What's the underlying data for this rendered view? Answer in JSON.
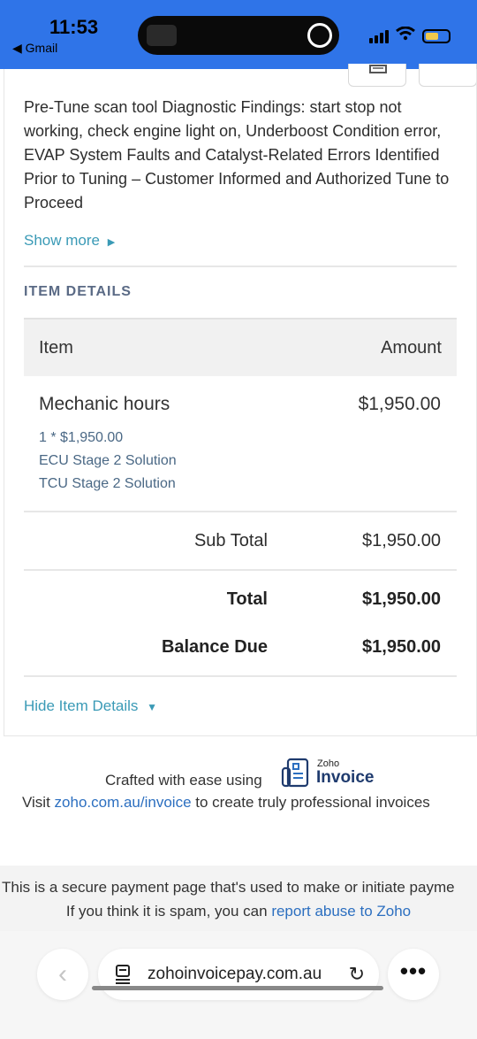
{
  "status_bar": {
    "time": "11:53",
    "back_app": "◀ Gmail"
  },
  "invoice": {
    "notes": "Pre-Tune scan tool Diagnostic Findings: start stop not working, check engine light on, Underboost Condition error, EVAP System Faults and Catalyst-Related Errors Identified Prior to Tuning – Customer Informed and Authorized Tune to Proceed",
    "show_more": "Show more",
    "section_title": "ITEM DETAILS",
    "columns": {
      "item": "Item",
      "amount": "Amount"
    },
    "line_item": {
      "title": "Mechanic hours",
      "amount": "$1,950.00",
      "details": [
        "1 * $1,950.00",
        "ECU Stage 2 Solution",
        "TCU Stage 2 Solution"
      ]
    },
    "sub_total": {
      "label": "Sub Total",
      "value": "$1,950.00"
    },
    "total": {
      "label": "Total",
      "value": "$1,950.00"
    },
    "balance_due": {
      "label": "Balance Due",
      "value": "$1,950.00"
    },
    "hide_items": "Hide Item Details"
  },
  "footer": {
    "crafted": "Crafted with ease using",
    "brand_small": "Zoho",
    "brand_big": "Invoice",
    "visit_prefix": "Visit",
    "visit_link": "zoho.com.au/invoice",
    "visit_suffix": "to create truly professional invoices"
  },
  "secure": {
    "line1": "This is a secure payment page that's used to make or initiate payme",
    "line2_prefix": "If you think it is spam, you can",
    "line2_link": "report abuse to Zoho"
  },
  "browser": {
    "url": "zohoinvoicepay.com.au"
  },
  "colors": {
    "status_bar": "#2f74e8",
    "link_teal": "#3a9ab6",
    "link_blue": "#2c6fc0",
    "section_title": "#5a6a85"
  }
}
